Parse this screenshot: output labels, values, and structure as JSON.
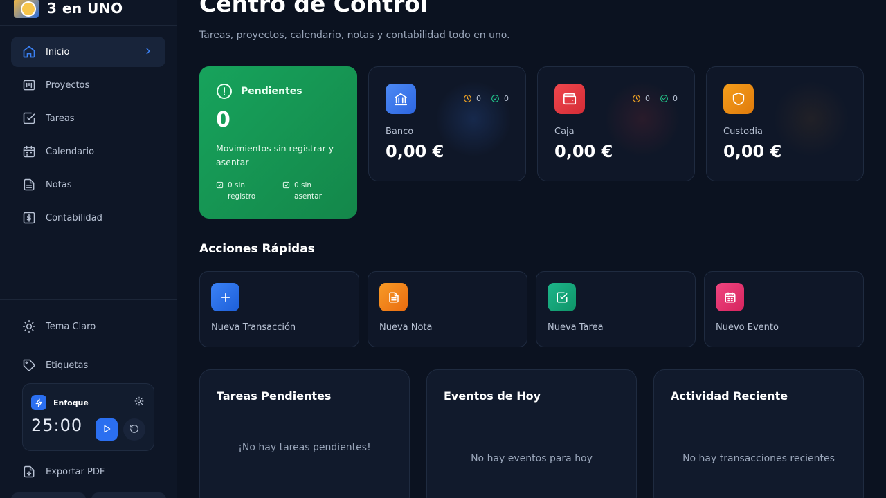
{
  "app": {
    "name": "3 en UNO"
  },
  "sidebar": {
    "items": [
      {
        "label": "Inicio",
        "icon": "home-icon",
        "active": true
      },
      {
        "label": "Proyectos",
        "icon": "projects-icon"
      },
      {
        "label": "Tareas",
        "icon": "tasks-icon"
      },
      {
        "label": "Calendario",
        "icon": "calendar-icon"
      },
      {
        "label": "Notas",
        "icon": "notes-icon"
      },
      {
        "label": "Contabilidad",
        "icon": "dollar-icon"
      }
    ],
    "theme_label": "Tema Claro",
    "tags_label": "Etiquetas",
    "focus": {
      "label": "Enfoque",
      "time": "25:00"
    },
    "export_label": "Exportar PDF"
  },
  "header": {
    "title": "Centro de Control",
    "subtitle": "Tareas, proyectos, calendario, notas y contabilidad todo en uno."
  },
  "pending": {
    "title": "Pendientes",
    "count": "0",
    "description": "Movimientos sin registrar y asentar",
    "unregistered": "0 sin registro",
    "unposted": "0 sin asentar"
  },
  "balances": [
    {
      "label": "Banco",
      "amount": "0,00 €",
      "pending": "0",
      "done": "0",
      "color": "#3b7bf0",
      "icon": "bank-icon"
    },
    {
      "label": "Caja",
      "amount": "0,00 €",
      "pending": "0",
      "done": "0",
      "color": "#e5393f",
      "icon": "wallet-icon"
    },
    {
      "label": "Custodia",
      "amount": "0,00 €",
      "color": "#f08c1a",
      "icon": "shield-icon"
    }
  ],
  "quick_actions": {
    "title": "Acciones Rápidas",
    "items": [
      {
        "label": "Nueva Transacción",
        "icon": "plus-icon",
        "color": "#2b6ff0"
      },
      {
        "label": "Nueva Nota",
        "icon": "note-icon",
        "color": "#f2841b"
      },
      {
        "label": "Nueva Tarea",
        "icon": "check-square-icon",
        "color": "#16a37a"
      },
      {
        "label": "Nuevo Evento",
        "icon": "calendar-icon",
        "color": "#e8336f"
      }
    ]
  },
  "panels": [
    {
      "title": "Tareas Pendientes",
      "empty": "¡No hay tareas pendientes!"
    },
    {
      "title": "Eventos de Hoy",
      "empty": "No hay eventos para hoy"
    },
    {
      "title": "Actividad Reciente",
      "empty": "No hay transacciones recientes"
    }
  ]
}
